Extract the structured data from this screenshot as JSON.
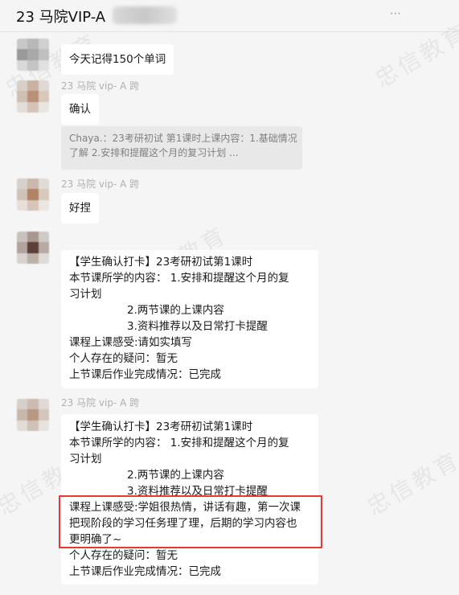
{
  "header": {
    "title": "23 马院VIP-A",
    "icons": [
      "more-icon"
    ]
  },
  "watermark": {
    "text": "忠信教育"
  },
  "messages": [
    {
      "sender": "",
      "lines": [
        "今天记得150个单词"
      ]
    },
    {
      "sender": "23 马院 vip- A 跨",
      "lines": [
        "确认"
      ],
      "quote": {
        "lines": [
          "Chaya.：23考研初试 第1课时上课内容：1.基础情况",
          "了解              2.安排和提醒这个月的复习计划 ..."
        ]
      }
    },
    {
      "sender": "23 马院 vip- A 跨",
      "lines": [
        "好捏"
      ]
    },
    {
      "sender": "",
      "lines": [
        "【学生确认打卡】23考研初试第1课时",
        "本节课所学的内容：      1.安排和提醒这个月的复",
        "习计划",
        "2.两节课的上课内容",
        "3.资料推荐以及日常打卡提醒",
        "课程上课感受:请如实填写",
        "个人存在的疑问：暂无",
        "上节课后作业完成情况：已完成"
      ]
    },
    {
      "sender": "23 马院 vip- A 跨",
      "lines": [
        "【学生确认打卡】23考研初试第1课时",
        "本节课所学的内容：      1.安排和提醒这个月的复",
        "习计划",
        "2.两节课的上课内容",
        "3.资料推荐以及日常打卡提醒",
        "课程上课感受:学姐很热情，讲话有趣，第一次课",
        "把现阶段的学习任务理了理，后期的学习内容也",
        "更明确了~",
        "个人存在的疑问：暂无",
        "上节课后作业完成情况：已完成"
      ]
    }
  ]
}
